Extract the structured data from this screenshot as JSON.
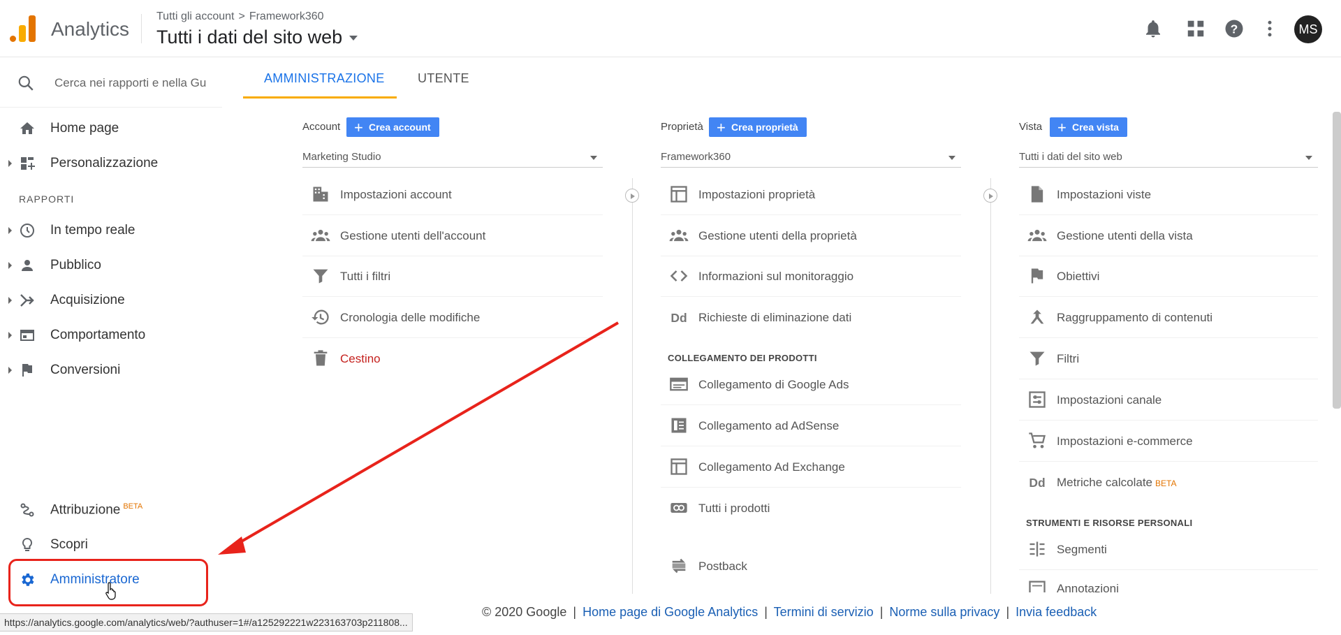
{
  "colors": {
    "accent": "#1a73e8",
    "primary_button": "#4285f4",
    "tab_indicator": "#f9ab00",
    "annotation": "#e8231b",
    "beta": "#e37400"
  },
  "header": {
    "product": "Analytics",
    "breadcrumb": {
      "root": "Tutti gli account",
      "separator": ">",
      "account": "Framework360"
    },
    "view_title": "Tutti i dati del sito web",
    "avatar_initials": "MS",
    "icons": [
      "bell-icon",
      "apps-grid-icon",
      "help-icon",
      "more-vert-icon"
    ]
  },
  "sidebar": {
    "search_placeholder": "Cerca nei rapporti e nella Gu",
    "items_top": [
      {
        "label": "Home page",
        "icon": "home-icon"
      },
      {
        "label": "Personalizzazione",
        "icon": "dashboard-icon"
      }
    ],
    "section_label": "RAPPORTI",
    "reports": [
      {
        "label": "In tempo reale",
        "icon": "clock-icon"
      },
      {
        "label": "Pubblico",
        "icon": "person-icon"
      },
      {
        "label": "Acquisizione",
        "icon": "acquisition-icon"
      },
      {
        "label": "Comportamento",
        "icon": "behavior-icon"
      },
      {
        "label": "Conversioni",
        "icon": "flag-icon"
      }
    ],
    "bottom": [
      {
        "label": "Attribuzione",
        "badge": "BETA",
        "icon": "attribution-icon"
      },
      {
        "label": "Scopri",
        "icon": "lightbulb-icon"
      },
      {
        "label": "Amministratore",
        "icon": "gear-icon"
      }
    ]
  },
  "tabs": [
    {
      "label": "AMMINISTRAZIONE",
      "active": true
    },
    {
      "label": "UTENTE",
      "active": false
    }
  ],
  "columns": {
    "account": {
      "caption": "Account",
      "create_label": "Crea account",
      "selected": "Marketing Studio",
      "rows": [
        {
          "label": "Impostazioni account",
          "icon": "building-icon"
        },
        {
          "label": "Gestione utenti dell'account",
          "icon": "people-icon"
        },
        {
          "label": "Tutti i filtri",
          "icon": "filter-icon"
        },
        {
          "label": "Cronologia delle modifiche",
          "icon": "history-icon"
        },
        {
          "label": "Cestino",
          "icon": "trash-icon"
        }
      ]
    },
    "property": {
      "caption": "Proprietà",
      "create_label": "Crea proprietà",
      "selected": "Framework360",
      "rows": [
        {
          "label": "Impostazioni proprietà",
          "icon": "window-icon"
        },
        {
          "label": "Gestione utenti della proprietà",
          "icon": "people-icon"
        },
        {
          "label": "Informazioni sul monitoraggio",
          "icon": "code-icon"
        },
        {
          "label": "Richieste di eliminazione dati",
          "icon": "dd-icon"
        }
      ],
      "subsection": "COLLEGAMENTO DEI PRODOTTI",
      "links": [
        {
          "label": "Collegamento di Google Ads",
          "icon": "ads-icon"
        },
        {
          "label": "Collegamento ad AdSense",
          "icon": "adsense-icon"
        },
        {
          "label": "Collegamento Ad Exchange",
          "icon": "adexchange-icon"
        },
        {
          "label": "Tutti i prodotti",
          "icon": "link-icon"
        }
      ],
      "extra": {
        "label": "Postback",
        "icon": "postback-icon"
      }
    },
    "view": {
      "caption": "Vista",
      "create_label": "Crea vista",
      "selected": "Tutti i dati del sito web",
      "rows": [
        {
          "label": "Impostazioni viste",
          "icon": "document-icon"
        },
        {
          "label": "Gestione utenti della vista",
          "icon": "people-icon"
        },
        {
          "label": "Obiettivi",
          "icon": "flag-icon"
        },
        {
          "label": "Raggruppamento di contenuti",
          "icon": "grouping-icon"
        },
        {
          "label": "Filtri",
          "icon": "filter-icon"
        },
        {
          "label": "Impostazioni canale",
          "icon": "channel-icon"
        },
        {
          "label": "Impostazioni e-commerce",
          "icon": "cart-icon"
        },
        {
          "label": "Metriche calcolate",
          "badge": "BETA",
          "icon": "dd-icon"
        }
      ],
      "subsection": "STRUMENTI E RISORSE PERSONALI",
      "tools": [
        {
          "label": "Segmenti",
          "icon": "segments-icon"
        },
        {
          "label": "Annotazioni",
          "icon": "annotation-icon"
        }
      ]
    }
  },
  "footer": {
    "copyright": "© 2020 Google",
    "separator": "|",
    "links": [
      "Home page di Google Analytics",
      "Termini di servizio",
      "Norme sulla privacy",
      "Invia feedback"
    ]
  },
  "status_url": "https://analytics.google.com/analytics/web/?authuser=1#/a125292221w223163703p211808..."
}
